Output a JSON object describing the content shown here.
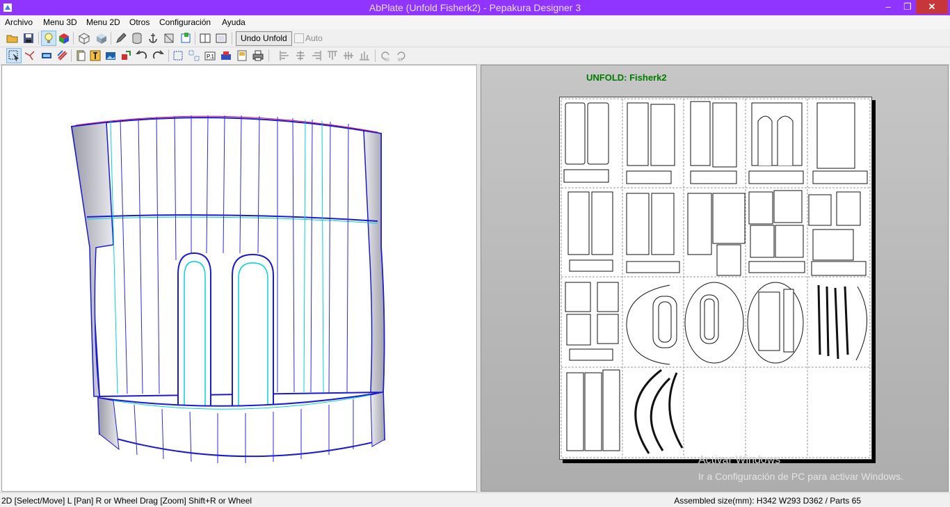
{
  "window": {
    "title": "AbPlate (Unfold Fisherk2) - Pepakura Designer 3"
  },
  "menu": [
    "Archivo",
    "Menu 3D",
    "Menu 2D",
    "Otros",
    "Configuración",
    "Ayuda"
  ],
  "toolbar1": {
    "undo_unfold_label": "Undo Unfold",
    "auto_label": "Auto"
  },
  "view2d": {
    "unfold_title": "UNFOLD: Fisherk2"
  },
  "watermark": {
    "line1": "Activar Windows",
    "line2": "Ir a Configuración de PC para activar Windows."
  },
  "status": {
    "left": "2D [Select/Move] L [Pan] R or Wheel Drag [Zoom] Shift+R or Wheel",
    "right": "Assembled size(mm): H342 W293 D362 / Parts 65"
  },
  "colors": {
    "titlebar": "#8f35ff",
    "close": "#c7373a",
    "unfold_title": "#007a00",
    "edge_blue": "#1010d0",
    "edge_cyan": "#00d0e0"
  },
  "icons": [
    "app-icon",
    "minimize-icon",
    "maximize-icon",
    "close-icon",
    "open-folder-icon",
    "save-icon",
    "light-bulb-icon",
    "color-cube-icon",
    "wireframe-cube-icon",
    "textured-cube-icon",
    "pencil-icon",
    "cylinder-icon",
    "anchor-icon",
    "flaps-icon",
    "edge-id-icon",
    "single-view-icon",
    "dual-view-icon",
    "select-icon",
    "join-edge-icon",
    "flap-tool-icon",
    "fold-lines-icon",
    "pages-icon",
    "text-icon",
    "image-icon",
    "rotate-part-icon",
    "undo-icon",
    "redo-icon",
    "arrange-icon",
    "layout-icon",
    "page-number-icon",
    "print-icon",
    "print-preview-icon",
    "printer-icon",
    "align-left-icon",
    "align-center-icon",
    "align-right-icon",
    "align-top-icon",
    "align-middle-icon",
    "align-bottom-icon",
    "rotate-90-icon",
    "rotate-minus-90-icon"
  ]
}
